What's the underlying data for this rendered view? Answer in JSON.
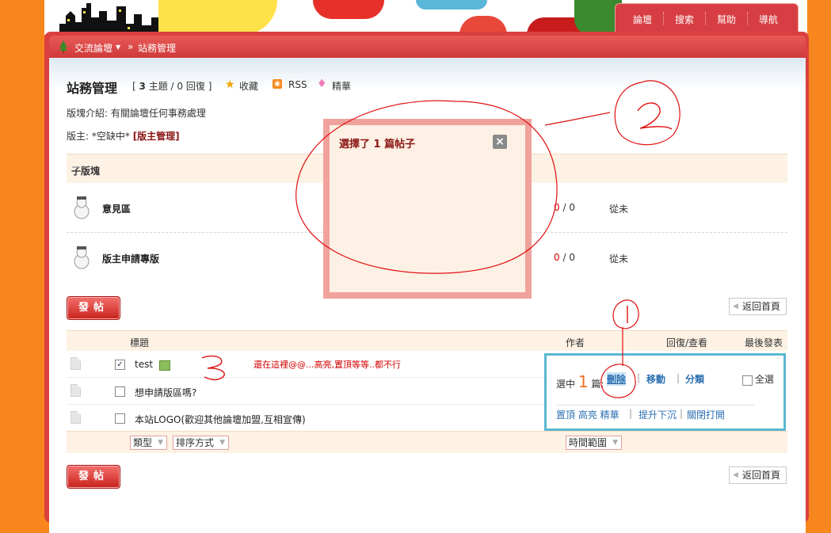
{
  "topnav": {
    "items": [
      "論壇",
      "搜索",
      "幫助",
      "導航"
    ]
  },
  "breadcrumb": {
    "home": "交流論壇",
    "separator": "»",
    "current": "站務管理"
  },
  "forum": {
    "title": "站務管理",
    "stats_open": "[",
    "threads": "3",
    "threads_label": "主題",
    "slash": "/",
    "replies": "0",
    "replies_label": "回復",
    "stats_close": "]",
    "favorite": "收藏",
    "rss": "RSS",
    "digest": "精華",
    "intro": "版塊介紹: 有關論壇任何事務處理",
    "moderator_label": "版主: *空缺中*",
    "moderator_link": "[版主管理]"
  },
  "subforums": {
    "header": "子版塊",
    "collapse": "—",
    "items": [
      {
        "name": "意見區",
        "threads": "0",
        "sep": "/",
        "posts": "0",
        "last": "從未"
      },
      {
        "name": "版主申請專版",
        "threads": "0",
        "sep": "/",
        "posts": "0",
        "last": "從未"
      }
    ]
  },
  "buttons": {
    "post": "發帖",
    "back": "返回首頁"
  },
  "table": {
    "headers": {
      "title": "標題",
      "author": "作者",
      "replies_views": "回復/查看",
      "last_post": "最後發表"
    },
    "rows": [
      {
        "title": "test",
        "checked": "✓"
      },
      {
        "title": "想申請版區嗎?",
        "checked": ""
      },
      {
        "title": "本站LOGO(歡迎其他論壇加盟,互相宣傳)",
        "checked": ""
      }
    ],
    "filters": {
      "type": "類型",
      "sort": "排序方式",
      "time_range": "時間範圍"
    }
  },
  "annotation_text": "還在這裡@@...高亮,置頂等等..都不行",
  "mod_panel": {
    "selected_prefix": "選中",
    "selected_count": "1",
    "selected_suffix": "篇:",
    "delete": "刪除",
    "move": "移動",
    "category": "分類",
    "select_all": "全選",
    "pin_highlight_digest": "置頂 高亮 精華",
    "bump": "提升下沉",
    "close_open": "關閉打開",
    "divider": "|"
  },
  "dialog": {
    "title": "選擇了 1 篇帖子",
    "close": "×"
  },
  "colors": {
    "accent_red": "#d9403f",
    "panel_border": "#5ab8d0",
    "dialog_border": "#f0a39c",
    "annotation": "#d40000"
  }
}
